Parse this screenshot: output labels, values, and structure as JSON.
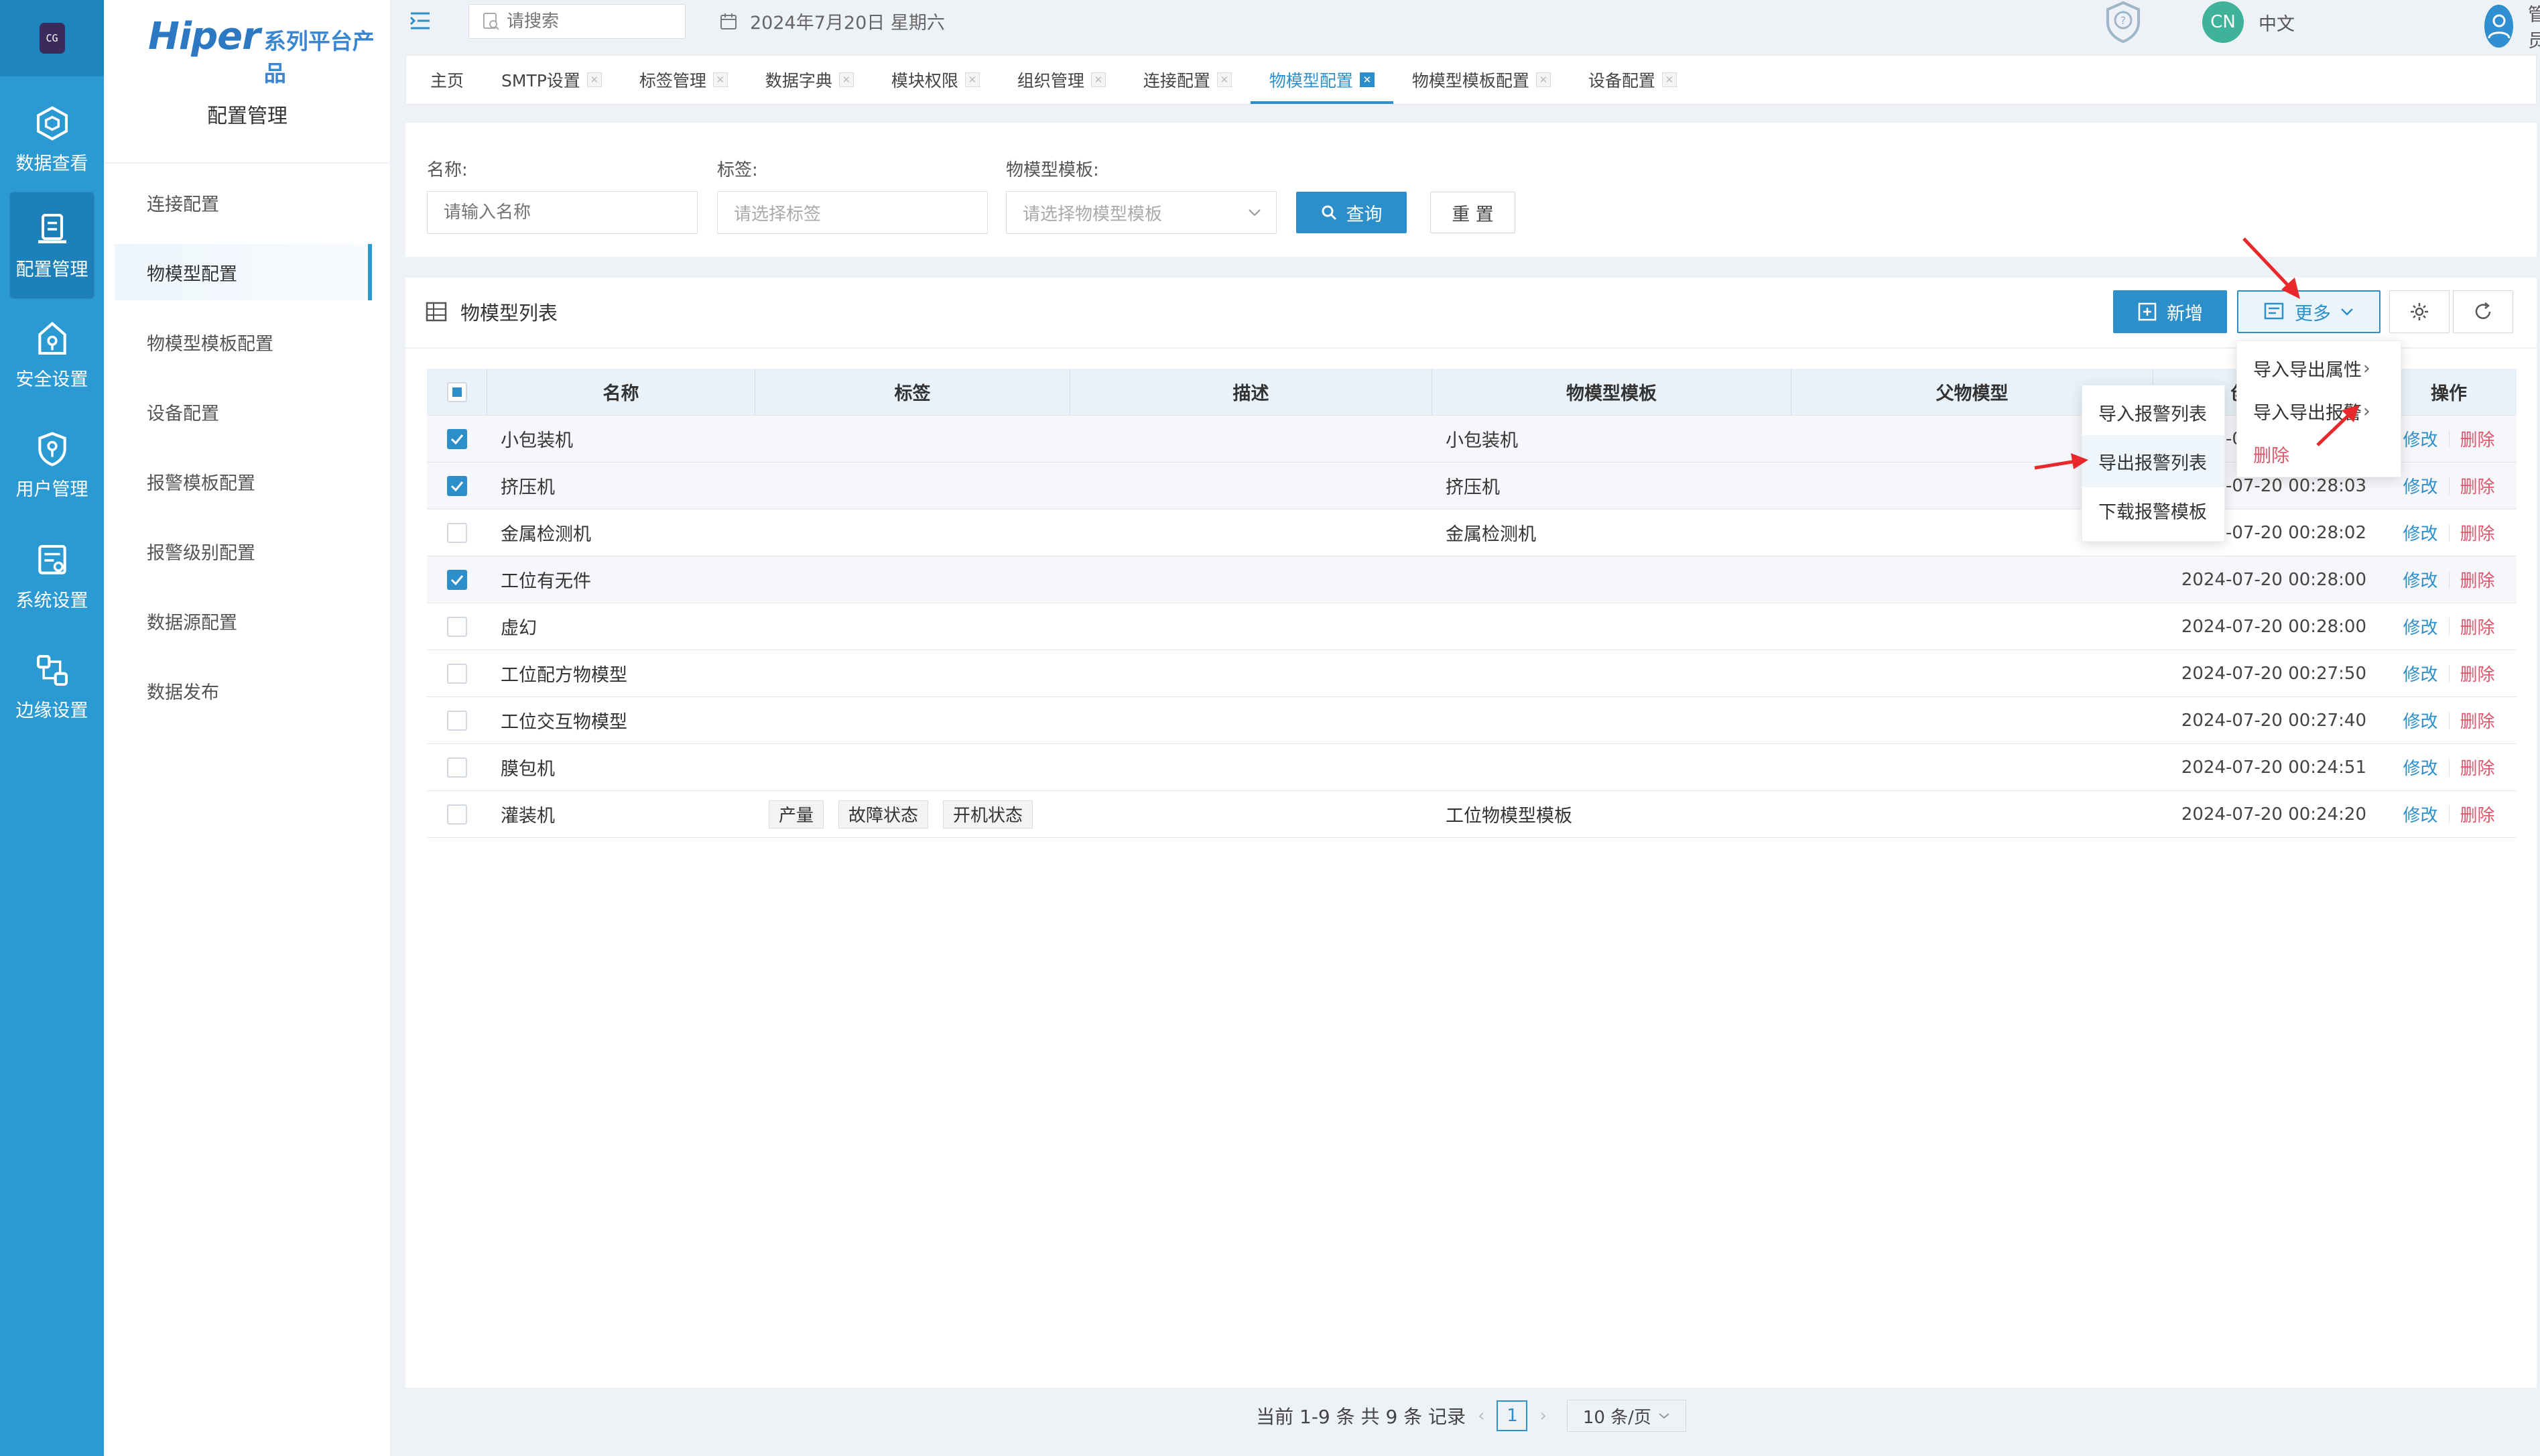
{
  "rail": {
    "logo_text": "CG",
    "items": [
      {
        "label": "数据查看",
        "icon": "cube-icon"
      },
      {
        "label": "配置管理",
        "icon": "config-icon"
      },
      {
        "label": "安全设置",
        "icon": "security-icon"
      },
      {
        "label": "用户管理",
        "icon": "user-shield-icon"
      },
      {
        "label": "系统设置",
        "icon": "system-icon"
      },
      {
        "label": "边缘设置",
        "icon": "edge-icon"
      }
    ],
    "active_index": 1
  },
  "brand": {
    "name": "Hiper",
    "series": "系列平台产品"
  },
  "subnav": {
    "title": "配置管理",
    "items": [
      "连接配置",
      "物模型配置",
      "物模型模板配置",
      "设备配置",
      "报警模板配置",
      "报警级别配置",
      "数据源配置",
      "数据发布"
    ],
    "active_index": 1
  },
  "header": {
    "search_placeholder": "请搜索",
    "date": "2024年7月20日 星期六",
    "lang_badge": "CN",
    "lang_label": "中文",
    "user_name": "管理员"
  },
  "tabs": [
    {
      "label": "主页",
      "closable": false
    },
    {
      "label": "SMTP设置",
      "closable": true
    },
    {
      "label": "标签管理",
      "closable": true
    },
    {
      "label": "数据字典",
      "closable": true
    },
    {
      "label": "模块权限",
      "closable": true
    },
    {
      "label": "组织管理",
      "closable": true
    },
    {
      "label": "连接配置",
      "closable": true
    },
    {
      "label": "物模型配置",
      "closable": true,
      "active": true
    },
    {
      "label": "物模型模板配置",
      "closable": true
    },
    {
      "label": "设备配置",
      "closable": true
    }
  ],
  "filter": {
    "name_label": "名称:",
    "name_placeholder": "请输入名称",
    "tag_label": "标签:",
    "tag_placeholder": "请选择标签",
    "template_label": "物模型模板:",
    "template_placeholder": "请选择物模型模板",
    "query_label": "查询",
    "reset_label": "重 置"
  },
  "list": {
    "title": "物模型列表",
    "add_label": "新增",
    "more_label": "更多",
    "columns": [
      "名称",
      "标签",
      "描述",
      "物模型模板",
      "父物模型",
      "创建时间",
      "操作"
    ],
    "edit_label": "修改",
    "delete_label": "删除",
    "rows": [
      {
        "checked": true,
        "name": "小包装机",
        "tags": [],
        "desc": "",
        "template": "小包装机",
        "parent": "",
        "time": "2024-07-20 00:28:05"
      },
      {
        "checked": true,
        "name": "挤压机",
        "tags": [],
        "desc": "",
        "template": "挤压机",
        "parent": "",
        "time": "2024-07-20 00:28:03"
      },
      {
        "checked": false,
        "name": "金属检测机",
        "tags": [],
        "desc": "",
        "template": "金属检测机",
        "parent": "",
        "time": "2024-07-20 00:28:02"
      },
      {
        "checked": true,
        "name": "工位有无件",
        "tags": [],
        "desc": "",
        "template": "",
        "parent": "",
        "time": "2024-07-20 00:28:00"
      },
      {
        "checked": false,
        "name": "虚幻",
        "tags": [],
        "desc": "",
        "template": "",
        "parent": "",
        "time": "2024-07-20 00:28:00"
      },
      {
        "checked": false,
        "name": "工位配方物模型",
        "tags": [],
        "desc": "",
        "template": "",
        "parent": "",
        "time": "2024-07-20 00:27:50"
      },
      {
        "checked": false,
        "name": "工位交互物模型",
        "tags": [],
        "desc": "",
        "template": "",
        "parent": "",
        "time": "2024-07-20 00:27:40"
      },
      {
        "checked": false,
        "name": "膜包机",
        "tags": [],
        "desc": "",
        "template": "",
        "parent": "",
        "time": "2024-07-20 00:24:51"
      },
      {
        "checked": false,
        "name": "灌装机",
        "tags": [
          "产量",
          "故障状态",
          "开机状态"
        ],
        "desc": "",
        "template": "工位物模型模板",
        "parent": "",
        "time": "2024-07-20 00:24:20"
      }
    ]
  },
  "menu_more": {
    "items": [
      "导入导出属性",
      "导入导出报警",
      "删除"
    ]
  },
  "menu_alarm": {
    "items": [
      "导入报警列表",
      "导出报警列表",
      "下载报警模板"
    ],
    "highlight_index": 1
  },
  "pager": {
    "summary": "当前 1-9 条 共 9 条 记录",
    "current_page": "1",
    "page_size": "10 条/页"
  },
  "colors": {
    "primary": "#2c8fc9",
    "rail": "#2c9ad2",
    "danger": "#e0566a",
    "annotation": "#e8282b"
  }
}
